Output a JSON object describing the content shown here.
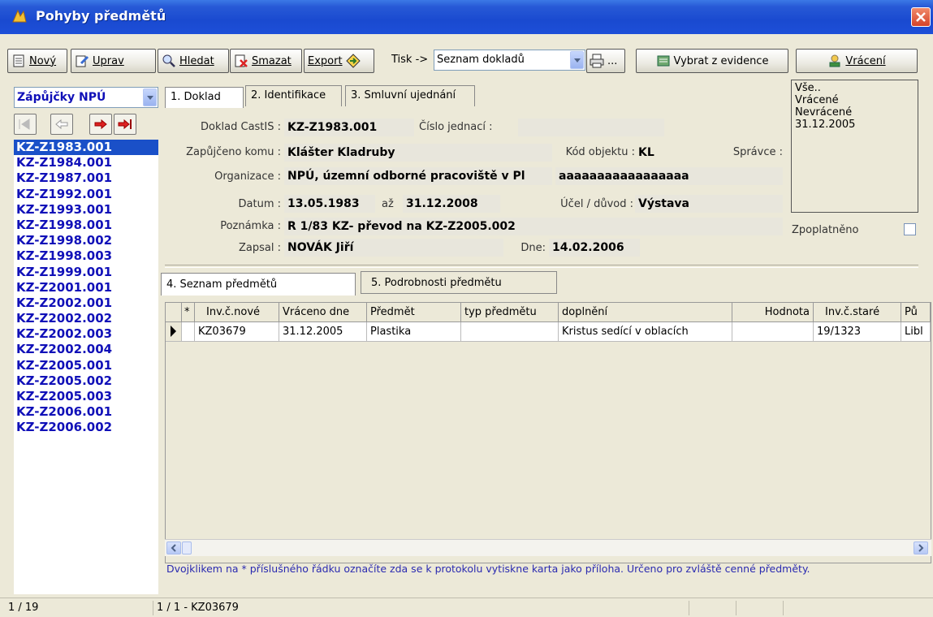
{
  "window": {
    "title": "Pohyby předmětů"
  },
  "toolbar": {
    "novy": "Nový",
    "uprav": "Uprav",
    "hledat": "Hledat",
    "smazat": "Smazat",
    "export": "Export",
    "tisk_label": "Tisk ->",
    "tisk_value": "Seznam dokladů",
    "print_more": "...",
    "vybrat": "Vybrat z evidence",
    "vraceni": "Vrácení"
  },
  "sidebar": {
    "filter": "Zápůjčky NPÚ",
    "items": [
      "KZ-Z1983.001",
      "KZ-Z1984.001",
      "KZ-Z1987.001",
      "KZ-Z1992.001",
      "KZ-Z1993.001",
      "KZ-Z1998.001",
      "KZ-Z1998.002",
      "KZ-Z1998.003",
      "KZ-Z1999.001",
      "KZ-Z2001.001",
      "KZ-Z2002.001",
      "KZ-Z2002.002",
      "KZ-Z2002.003",
      "KZ-Z2002.004",
      "KZ-Z2005.001",
      "KZ-Z2005.002",
      "KZ-Z2005.003",
      "KZ-Z2006.001",
      "KZ-Z2006.002"
    ],
    "selected": "KZ-Z1983.001"
  },
  "tabs_top": [
    "1. Doklad",
    "2. Identifikace",
    "3. Smluvní ujednání"
  ],
  "form": {
    "doklad_label": "Doklad CastIS :",
    "doklad": "KZ-Z1983.001",
    "cislo_label": "Číslo jednací :",
    "cislo": "",
    "komu_label": "Zapůjčeno komu :",
    "komu": "Klášter Kladruby",
    "kod_label": "Kód objektu :",
    "kod": "KL",
    "spravce_label": "Správce :",
    "org_label": "Organizace :",
    "org": "NPÚ, územní odborné pracoviště v Pl",
    "org2": "aaaaaaaaaaaaaaaaa",
    "datum_label": "Datum :",
    "datum_od": "13.05.1983",
    "az": "až",
    "datum_do": "31.12.2008",
    "ucel_label": "Účel / důvod :",
    "ucel": "Výstava",
    "poznamka_label": "Poznámka :",
    "poznamka": "R 1/83 KZ- převod na KZ-Z2005.002",
    "zapsal_label": "Zapsal :",
    "zapsal": "NOVÁK Jiří",
    "dne_label": "Dne:",
    "dne": "14.02.2006",
    "zpoplatneno": "Zpoplatněno"
  },
  "status_list": [
    "Vše..",
    "Vrácené",
    "Nevrácené",
    "31.12.2005"
  ],
  "tabs_bottom": [
    "4. Seznam předmětů",
    "5. Podrobnosti předmětu"
  ],
  "table": {
    "headers": [
      "*",
      "Inv.č.nové",
      "Vráceno dne",
      "Předmět",
      "typ předmětu",
      "doplnění",
      "Hodnota",
      "Inv.č.staré",
      "Pů"
    ],
    "rows": [
      [
        "",
        "KZ03679",
        "31.12.2005",
        "Plastika",
        "",
        "Kristus sedící v oblacích",
        "",
        "19/1323",
        "Libl"
      ]
    ]
  },
  "hint": "Dvojklikem na * příslušného řádku označíte zda se k protokolu vytiskne karta jako příloha. Určeno pro zvláště cenné předměty.",
  "statusbar": {
    "left": "1 / 19",
    "right": "1 / 1 - KZ03679"
  },
  "colors": {
    "title": "#1d4fd8",
    "list_text": "#1010b8",
    "selection": "#1a50c8",
    "hint": "#2a2ab0"
  }
}
